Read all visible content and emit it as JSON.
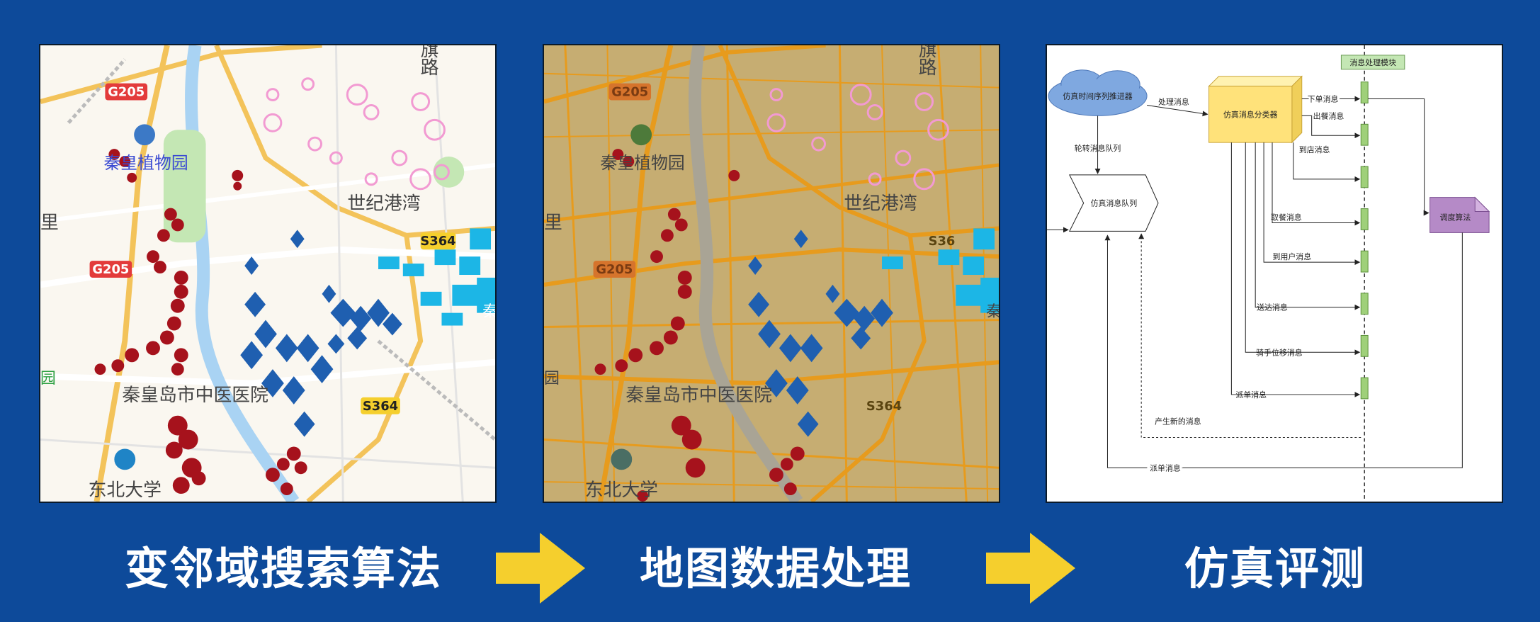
{
  "map_labels": {
    "g205_top": "G205",
    "g205_mid": "G205",
    "garden": "秦皇植物园",
    "bay": "世纪港湾",
    "s364_top": "S364",
    "s364_bottom": "S364",
    "hospital": "秦皇岛市中医医院",
    "university": "东北大学",
    "road_qi": "旗",
    "road_lu": "路",
    "edge_li": "里",
    "edge_yuan": "园",
    "edge_qin": "秦",
    "s364_cut": "S36"
  },
  "diagram": {
    "pusher": "仿真时间序列推进器",
    "process_msg": "处理消息",
    "classifier": "仿真消息分类器",
    "module": "消息处理模块",
    "order_msg": "下单消息",
    "meal_out_msg": "出餐消息",
    "arrive_store_msg": "到店消息",
    "rotate_queue": "轮转消息队列",
    "queue": "仿真消息队列",
    "dispatch_algo": "调度算法",
    "pickup_msg": "取餐消息",
    "arrive_user_msg": "到用户消息",
    "delivered_msg": "送达消息",
    "rider_move_msg": "骑手位移消息",
    "assign_msg": "派单消息",
    "new_msg": "产生新的消息",
    "assign_msg_bottom": "派单消息"
  },
  "captions": {
    "step1": "变邻域搜索算法",
    "step2": "地图数据处理",
    "step3": "仿真评测"
  },
  "colors": {
    "background": "#0d4a9a",
    "arrow": "#f5cf2d",
    "cluster_red": "#a6121c",
    "cluster_blue": "#1f5fb0",
    "cluster_cyan": "#1cb6e6",
    "cluster_pink": "#f29ad2"
  }
}
